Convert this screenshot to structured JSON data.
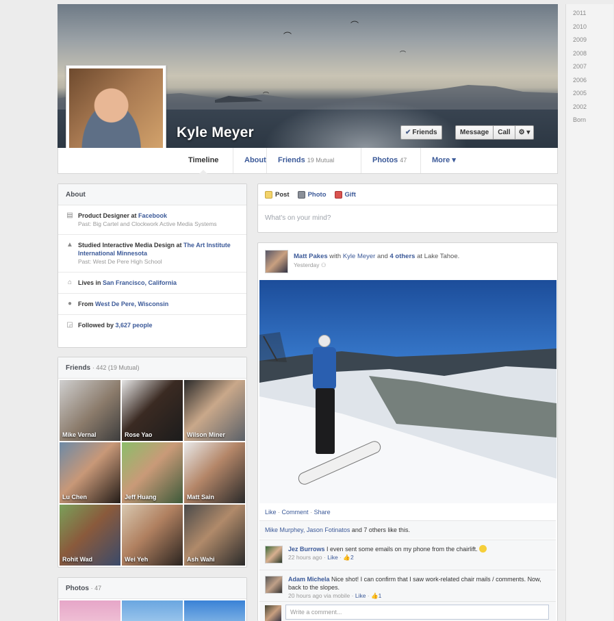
{
  "timeline_years": [
    "2011",
    "2010",
    "2009",
    "2008",
    "2007",
    "2006",
    "2005",
    "2002",
    "Born"
  ],
  "profile": {
    "name": "Kyle Meyer",
    "actions": {
      "friends": "Friends",
      "message": "Message",
      "call": "Call",
      "settings_icon": "gear-icon"
    }
  },
  "tabs": [
    {
      "label": "Timeline",
      "count": ""
    },
    {
      "label": "About",
      "count": ""
    },
    {
      "label": "Friends",
      "count": "19 Mutual"
    },
    {
      "label": "Photos",
      "count": "47"
    },
    {
      "label": "More ▾",
      "count": ""
    }
  ],
  "about": {
    "title": "About",
    "items": [
      {
        "icon": "briefcase-icon",
        "prefix": "Product Designer at ",
        "link": "Facebook",
        "past": "Past: Big Cartel and Clockwork Active Media Systems"
      },
      {
        "icon": "graduation-cap-icon",
        "prefix": "Studied Interactive Media Design at ",
        "link": "The Art Institute International Minnesota",
        "past": "Past: West De Pere High School"
      },
      {
        "icon": "house-icon",
        "prefix": "Lives in ",
        "link": "San Francisco, California",
        "past": ""
      },
      {
        "icon": "location-pin-icon",
        "prefix": "From ",
        "link": "West De Pere, Wisconsin",
        "past": ""
      },
      {
        "icon": "rss-icon",
        "prefix": "Followed by ",
        "link": "3,627 people",
        "past": ""
      }
    ]
  },
  "friends_card": {
    "title": "Friends",
    "count": "· 442 (19 Mutual)",
    "friends": [
      "Mike Vernal",
      "Rose Yao",
      "Wilson Miner",
      "Lu Chen",
      "Jeff Huang",
      "Matt Sain",
      "Rohit Wad",
      "Wei Yeh",
      "Ash Wahi"
    ]
  },
  "photos_card": {
    "title": "Photos",
    "count": "· 47"
  },
  "composer": {
    "post": "Post",
    "photo": "Photo",
    "gift": "Gift",
    "placeholder": "What's on your mind?"
  },
  "post": {
    "author": "Matt Pakes",
    "with_text": " with ",
    "tagged": "Kyle Meyer",
    "and_text": " and ",
    "others": "4 others",
    "at_text": " at ",
    "place": "Lake Tahoe.",
    "time": "Yesterday",
    "actions": {
      "like": "Like",
      "comment": "Comment",
      "share": "Share"
    },
    "likes_names": "Mike Murphey, Jason Fotinatos",
    "likes_rest": " and 7 others like this.",
    "comments": [
      {
        "author": "Jez Burrows",
        "text": "I even sent some emails on my phone from the chairlift.",
        "time": "22 hours ago",
        "via": "",
        "like": "Like",
        "likes": "2"
      },
      {
        "author": "Adam Michela",
        "text": "Nice shot! I can confirm that I saw work-related chair mails / comments. Now, back to the slopes.",
        "time": "20 hours ago",
        "via": " via mobile",
        "like": "Like",
        "likes": "1"
      }
    ],
    "write_placeholder": "Write a comment..."
  },
  "colors": {
    "link": "#3b5998",
    "background": "#ececec"
  }
}
